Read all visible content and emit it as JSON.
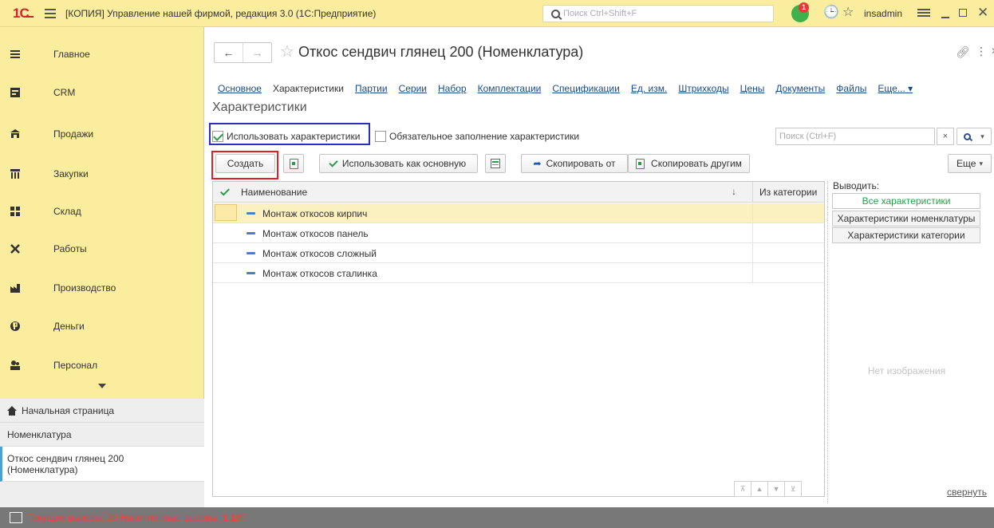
{
  "app": {
    "title": "[КОПИЯ] Управление нашей фирмой, редакция 3.0  (1С:Предприятие)",
    "logo_text": "1С",
    "search_placeholder": "Поиск Ctrl+Shift+F",
    "notification_count": "1",
    "user": "insadmin",
    "colors": {
      "titlebar": "#fbed9e",
      "accent_green": "#2a9d45",
      "link_blue": "#1a4c8b",
      "highlight_red": "#e01f26",
      "highlight_blue": "#2b2fbf",
      "status_red": "#ff3b3b"
    }
  },
  "sidebar": {
    "items": [
      {
        "label": "Главное",
        "icon": "menu-lines-icon"
      },
      {
        "label": "CRM",
        "icon": "crm-icon"
      },
      {
        "label": "Продажи",
        "icon": "shop-icon"
      },
      {
        "label": "Закупки",
        "icon": "cart-icon"
      },
      {
        "label": "Склад",
        "icon": "warehouse-icon"
      },
      {
        "label": "Работы",
        "icon": "tools-icon"
      },
      {
        "label": "Производство",
        "icon": "factory-icon"
      },
      {
        "label": "Деньги",
        "icon": "money-icon"
      },
      {
        "label": "Персонал",
        "icon": "people-icon"
      }
    ],
    "history": [
      {
        "label": "Начальная страница"
      },
      {
        "label": "Номенклатура"
      },
      {
        "label": "Откос сендвич глянец 200 (Номенклатура)"
      }
    ]
  },
  "form": {
    "title": "Откос сендвич глянец 200 (Номенклатура)",
    "tabs": [
      "Основное",
      "Характеристики",
      "Партии",
      "Серии",
      "Набор",
      "Комплектации",
      "Спецификации",
      "Ед. изм.",
      "Штрихкоды",
      "Цены",
      "Документы",
      "Файлы",
      "Еще..."
    ],
    "active_tab": "Характеристики",
    "section_title": "Характеристики",
    "use_characteristics_label": "Использовать характеристики",
    "use_characteristics_checked": true,
    "required_fill_label": "Обязательное заполнение характеристики",
    "required_fill_checked": false,
    "search_placeholder": "Поиск (Ctrl+F)",
    "search_clear": "×",
    "toolbar": {
      "create": "Создать",
      "use_as_main": "Использовать как основную",
      "copy_from": "Скопировать от",
      "copy_to_others": "Скопировать другим",
      "more": "Еще"
    },
    "table": {
      "columns": [
        "Наименование",
        "Из категории"
      ],
      "rows": [
        {
          "name": "Монтаж откосов кирпич",
          "selected": true
        },
        {
          "name": "Монтаж откосов панель",
          "selected": false
        },
        {
          "name": "Монтаж откосов сложный",
          "selected": false
        },
        {
          "name": "Монтаж откосов сталинка",
          "selected": false
        }
      ]
    },
    "output": {
      "label": "Выводить:",
      "options": [
        "Все характеристики",
        "Характеристики номенклатуры",
        "Характеристики категории"
      ],
      "active": "Все характеристики"
    },
    "no_image": "Нет изображения",
    "collapse": "свернуть"
  },
  "status": {
    "text": "Текущие вызовы: 20   Накопленные вызовы: 1 187"
  }
}
